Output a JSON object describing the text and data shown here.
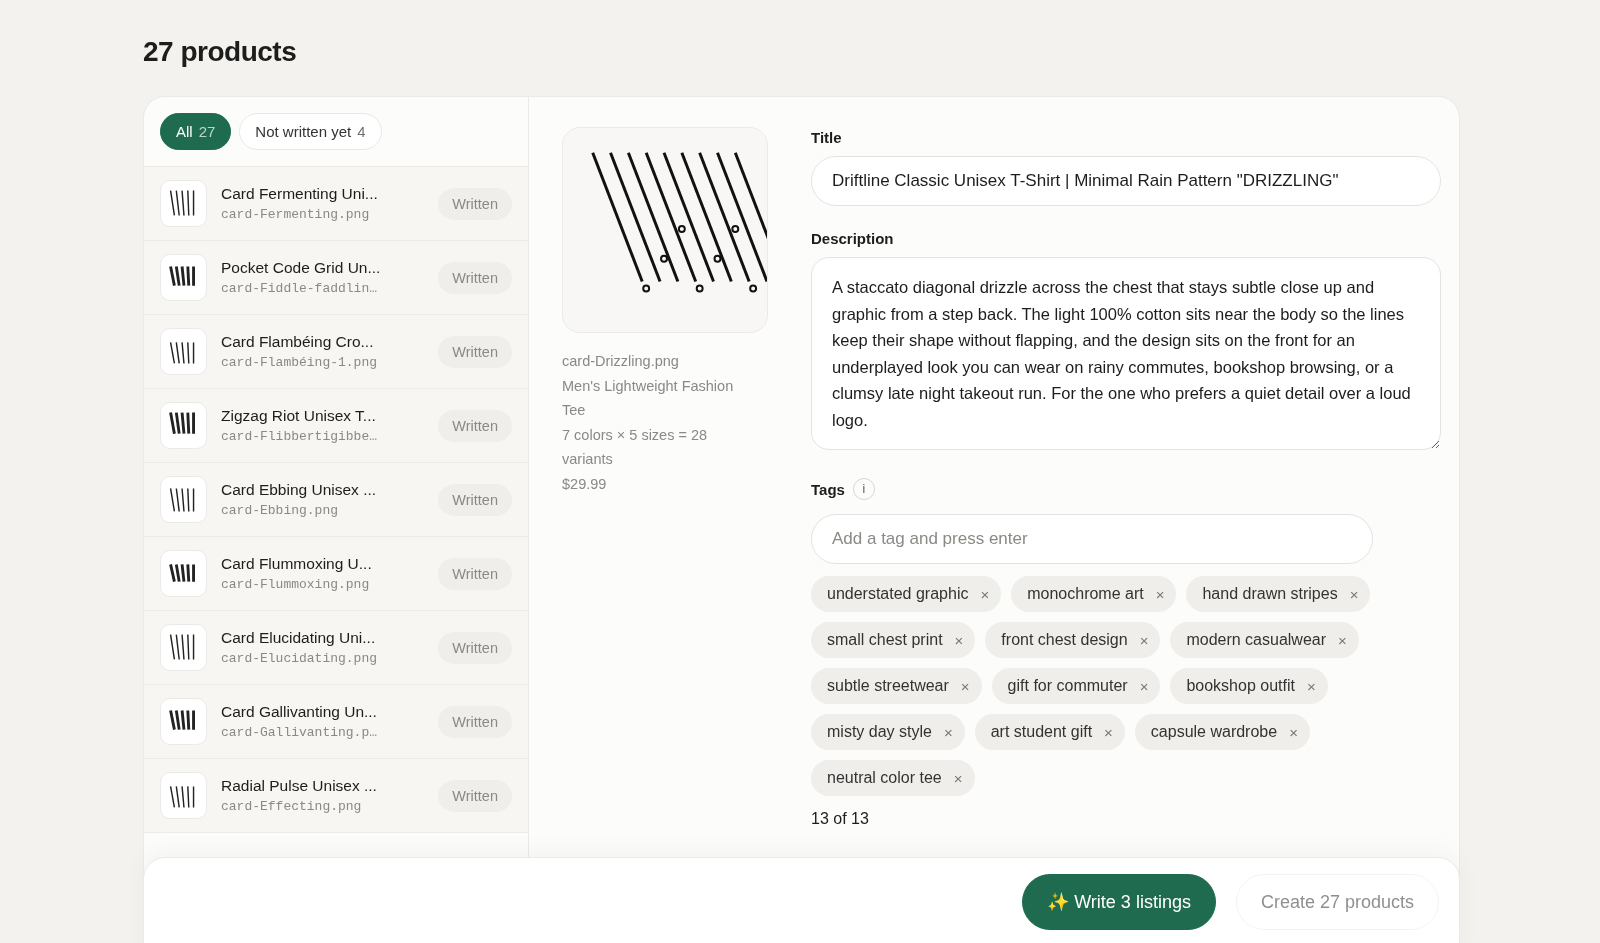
{
  "page_title": "27 products",
  "filters": [
    {
      "label": "All",
      "count": "27",
      "selected": true
    },
    {
      "label": "Not written yet",
      "count": "4",
      "selected": false
    }
  ],
  "products": [
    {
      "title": "Card Fermenting Uni...",
      "file": "card-Fermenting.png",
      "status": "Written"
    },
    {
      "title": "Pocket Code Grid Un...",
      "file": "card-Fiddle-faddlin…",
      "status": "Written"
    },
    {
      "title": "Card Flambéing Cro...",
      "file": "card-Flambéing-1.png",
      "status": "Written"
    },
    {
      "title": "Zigzag Riot Unisex T...",
      "file": "card-Flibbertigibbe…",
      "status": "Written"
    },
    {
      "title": "Card Ebbing Unisex ...",
      "file": "card-Ebbing.png",
      "status": "Written"
    },
    {
      "title": "Card Flummoxing U...",
      "file": "card-Flummoxing.png",
      "status": "Written"
    },
    {
      "title": "Card Elucidating Uni...",
      "file": "card-Elucidating.png",
      "status": "Written"
    },
    {
      "title": "Card Gallivanting Un...",
      "file": "card-Gallivanting.p…",
      "status": "Written"
    },
    {
      "title": "Radial Pulse Unisex ...",
      "file": "card-Effecting.png",
      "status": "Written"
    }
  ],
  "detail": {
    "file": "card-Drizzling.png",
    "product_type": "Men's Lightweight Fashion Tee",
    "variants": "7 colors × 5 sizes = 28 variants",
    "price": "$29.99"
  },
  "form": {
    "title_label": "Title",
    "title_value": "Driftline Classic Unisex T-Shirt | Minimal Rain Pattern \"DRIZZLING\"",
    "description_label": "Description",
    "description_value": "A staccato diagonal drizzle across the chest that stays subtle close up and graphic from a step back. The light 100% cotton sits near the body so the lines keep their shape without flapping, and the design sits on the front for an underplayed look you can wear on rainy commutes, bookshop browsing, or a clumsy late night takeout run. For the one who prefers a quiet detail over a loud logo.",
    "tags_label": "Tags",
    "tags_info": "i",
    "tag_placeholder": "Add a tag and press enter",
    "tags": [
      "understated graphic",
      "monochrome art",
      "hand drawn stripes",
      "small chest print",
      "front chest design",
      "modern casualwear",
      "subtle streetwear",
      "gift for commuter",
      "bookshop outfit",
      "misty day style",
      "art student gift",
      "capsule wardrobe",
      "neutral color tee"
    ],
    "tag_remove": "×",
    "tag_count": "13 of 13"
  },
  "actions": [
    {
      "kind": "primary",
      "icon": "✨",
      "label": "Write 3 listings",
      "disabled": false
    },
    {
      "kind": "secondary",
      "label": "Create 27 products",
      "disabled": true
    }
  ]
}
